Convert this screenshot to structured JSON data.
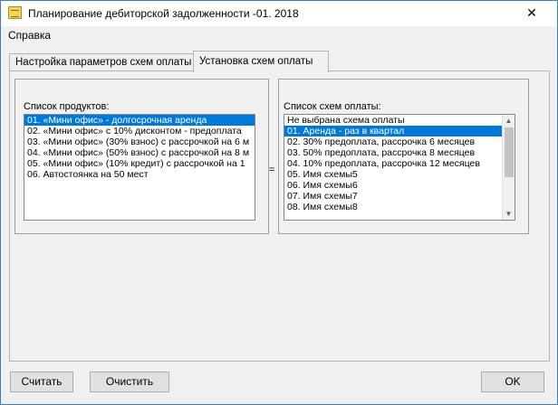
{
  "window": {
    "title": "Планирование дебиторской задолженности -01. 2018",
    "close_glyph": "✕"
  },
  "menu": {
    "help": "Справка"
  },
  "tabs": [
    {
      "label": "Настройка параметров схем оплаты",
      "active": false
    },
    {
      "label": "Установка схем оплаты",
      "active": true
    }
  ],
  "products": {
    "label": "Список продуктов:",
    "items": [
      {
        "text": "01. «Мини офис» - долгосрочная аренда",
        "selected": true
      },
      {
        "text": "02. «Мини офис» с 10% дисконтом - предоплата",
        "selected": false
      },
      {
        "text": "03. «Мини офис» (30% взнос) с рассрочкой на 6 м",
        "selected": false
      },
      {
        "text": "04. «Мини офис» (50% взнос) с рассрочкой на 8 м",
        "selected": false
      },
      {
        "text": "05. «Мини офис» (10% кредит) с рассрочкой на 1",
        "selected": false
      },
      {
        "text": "06. Автостоянка на 50 мест",
        "selected": false
      }
    ]
  },
  "equals_sign": "=",
  "schemes": {
    "label": "Список схем оплаты:",
    "items": [
      {
        "text": "Не выбрана схема оплаты",
        "selected": false
      },
      {
        "text": "01. Аренда - раз в квартал",
        "selected": true
      },
      {
        "text": "02. 30% предоплата, рассрочка 6 месяцев",
        "selected": false
      },
      {
        "text": "03. 50% предоплата, рассрочка 8 месяцев",
        "selected": false
      },
      {
        "text": "04. 10% предоплата, рассрочка 12 месяцев",
        "selected": false
      },
      {
        "text": "05. Имя схемы5",
        "selected": false
      },
      {
        "text": "06. Имя схемы6",
        "selected": false
      },
      {
        "text": "07. Имя схемы7",
        "selected": false
      },
      {
        "text": "08. Имя схемы8",
        "selected": false
      }
    ],
    "scroll_up_glyph": "▲",
    "scroll_down_glyph": "▼"
  },
  "buttons": {
    "count": "Считать",
    "clear": "Очистить",
    "ok": "OK"
  },
  "colors": {
    "selection": "#0078d7",
    "window_border": "#3c7fb1"
  }
}
